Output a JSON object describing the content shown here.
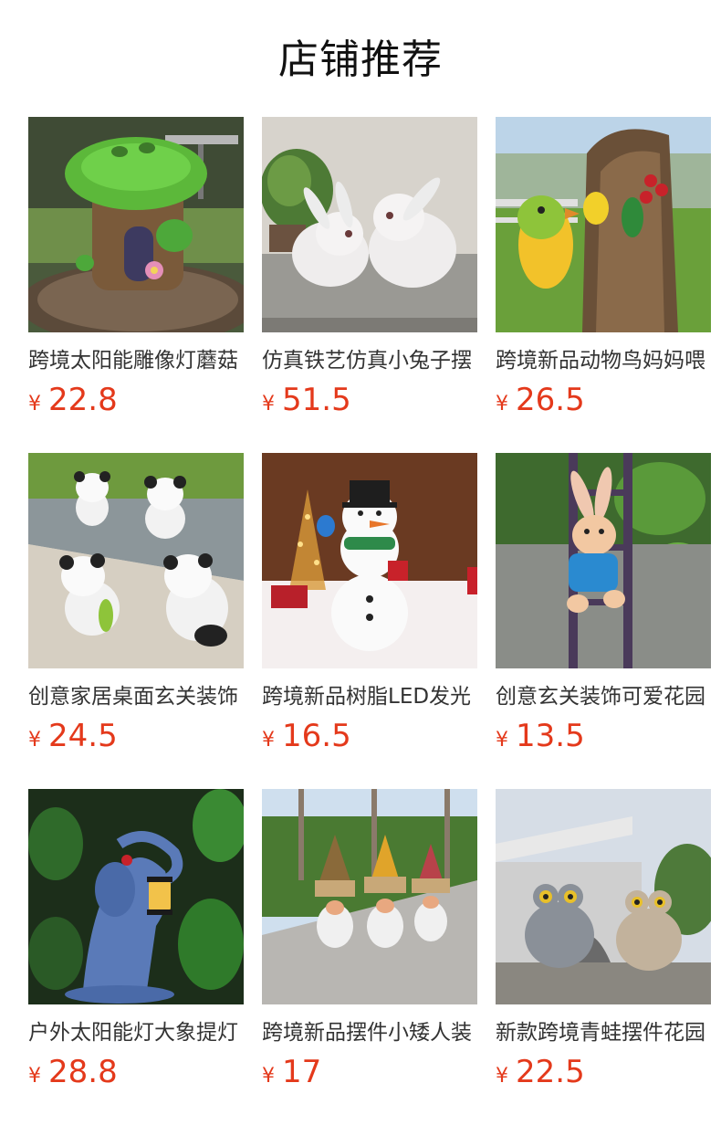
{
  "header": {
    "title": "店铺推荐"
  },
  "currency_symbol": "¥",
  "products": [
    {
      "name": "跨境太阳能雕像灯蘑菇",
      "price": "22.8",
      "image": "mushroom-house-solar-statue"
    },
    {
      "name": "仿真铁艺仿真小兔子摆",
      "price": "51.5",
      "image": "white-rabbit-pair"
    },
    {
      "name": "跨境新品动物鸟妈妈喂",
      "price": "26.5",
      "image": "bird-mother-tree-decor"
    },
    {
      "name": "创意家居桌面玄关装饰",
      "price": "24.5",
      "image": "panda-figurines"
    },
    {
      "name": "跨境新品树脂LED发光",
      "price": "16.5",
      "image": "snowman-led"
    },
    {
      "name": "创意玄关装饰可爱花园",
      "price": "13.5",
      "image": "rabbit-climbing-ladder"
    },
    {
      "name": "户外太阳能灯大象提灯",
      "price": "28.8",
      "image": "elephant-lantern-solar"
    },
    {
      "name": "跨境新品摆件小矮人装",
      "price": "17",
      "image": "gnome-trio"
    },
    {
      "name": "新款跨境青蛙摆件花园",
      "price": "22.5",
      "image": "frog-pair"
    }
  ]
}
